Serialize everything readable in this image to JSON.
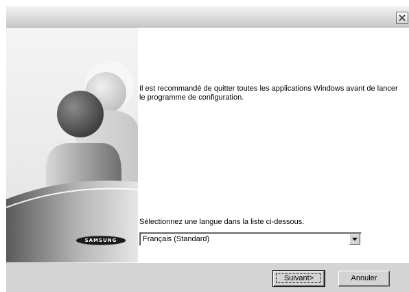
{
  "window": {
    "close_label": "close-icon"
  },
  "brand": {
    "logo_text": "SAMSUNG"
  },
  "main": {
    "message": "Il est recommandé de quitter toutes les applications Windows avant de lancer le programme de configuration.",
    "language_prompt": "Sélectionnez une langue dans la liste ci-dessous.",
    "language_selected": "Français (Standard)"
  },
  "footer": {
    "next_label": "Suivant>",
    "cancel_label": "Annuler"
  }
}
